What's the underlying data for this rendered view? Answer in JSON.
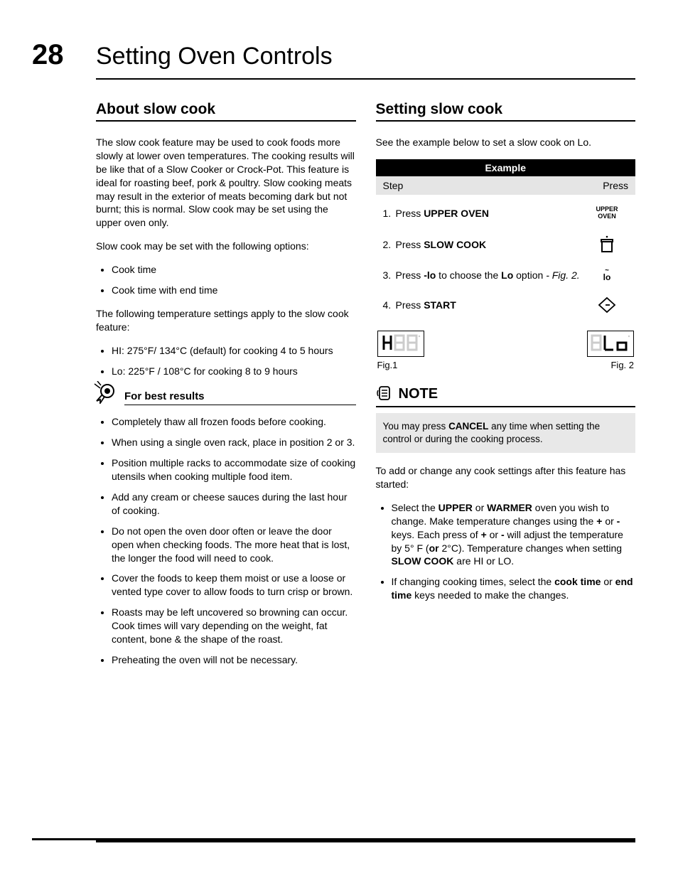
{
  "page_number": "28",
  "page_title": "Setting Oven Controls",
  "left": {
    "heading": "About slow cook",
    "intro": "The slow cook feature may be used to cook foods more slowly at lower oven temperatures. The cooking results will be like that of a Slow Cooker or Crock-Pot. This feature is ideal for roasting beef, pork & poultry. Slow cooking meats may result in the exterior of meats becoming dark but not burnt; this is normal. Slow cook may be set using the upper oven only.",
    "options_intro": "Slow cook may be set with the following options:",
    "options": [
      "Cook time",
      "Cook time with end time"
    ],
    "temp_intro": "The following temperature settings apply to the slow cook feature:",
    "temps": [
      "HI: 275°F/ 134°C (default) for cooking 4 to 5 hours",
      "Lo: 225°F / 108°C for cooking 8 to 9 hours"
    ],
    "best_heading": "For best results",
    "best": [
      "Completely thaw all frozen foods before cooking.",
      "When using a single oven rack, place in position 2 or 3.",
      "Position multiple racks to accommodate size of cooking utensils when cooking multiple food item.",
      "Add any cream or cheese sauces during the last hour of cooking.",
      "Do not open the oven door often or leave the door open when checking foods. The more heat that is lost, the longer the food will need to cook.",
      "Cover the foods to keep them moist or use a loose or vented type cover to allow foods to turn crisp or brown.",
      "Roasts may be left uncovered so browning can occur. Cook times will vary depending on the weight, fat content, bone & the shape of the roast.",
      "Preheating the oven will not be necessary."
    ]
  },
  "right": {
    "heading": "Setting slow cook",
    "intro": "See the example below to set a slow cook on Lo.",
    "example_label": "Example",
    "col_step": "Step",
    "col_press": "Press",
    "steps": {
      "s1_pre": "Press ",
      "s1_bold": "UPPER OVEN",
      "s1_btn_l1": "UPPER",
      "s1_btn_l2": "OVEN",
      "s2_pre": "Press ",
      "s2_bold": "SLOW COOK",
      "s3_pre": "Press ",
      "s3_b1": "-lo",
      "s3_mid": "  to choose the ",
      "s3_b2": "Lo",
      "s3_post": " option ",
      "s3_fig": "- Fig. 2.",
      "s3_btn": "lo",
      "s4_pre": "Press ",
      "s4_bold": "START"
    },
    "fig1_label": "Fig.1",
    "fig2_label": "Fig. 2",
    "note_label": "NOTE",
    "note_pre": "You may press ",
    "note_bold": "CANCEL",
    "note_post": " any time when setting the control or during the cooking process.",
    "change_intro": "To add or change any cook settings after this feature has started:",
    "change1_a": "Select the ",
    "change1_b1": "UPPER",
    "change1_b": " or ",
    "change1_b2": "WARMER",
    "change1_c": " oven you wish to change. Make temperature changes using the ",
    "change1_plus": "+",
    "change1_d": " or ",
    "change1_minus": "-",
    "change1_e": " keys. Each press of ",
    "change1_plus2": "+",
    "change1_f": " or ",
    "change1_minus2": "-",
    "change1_g": " will adjust the temperature by 5° F (",
    "change1_or": "or",
    "change1_h": " 2°C).  Temperature changes when setting ",
    "change1_sc": "SLOW COOK",
    "change1_i": " are HI or LO.",
    "change2_a": "If changing cooking times, select the ",
    "change2_b1": "cook time",
    "change2_b": " or ",
    "change2_b2": "end time",
    "change2_c": " keys needed to make the changes."
  }
}
